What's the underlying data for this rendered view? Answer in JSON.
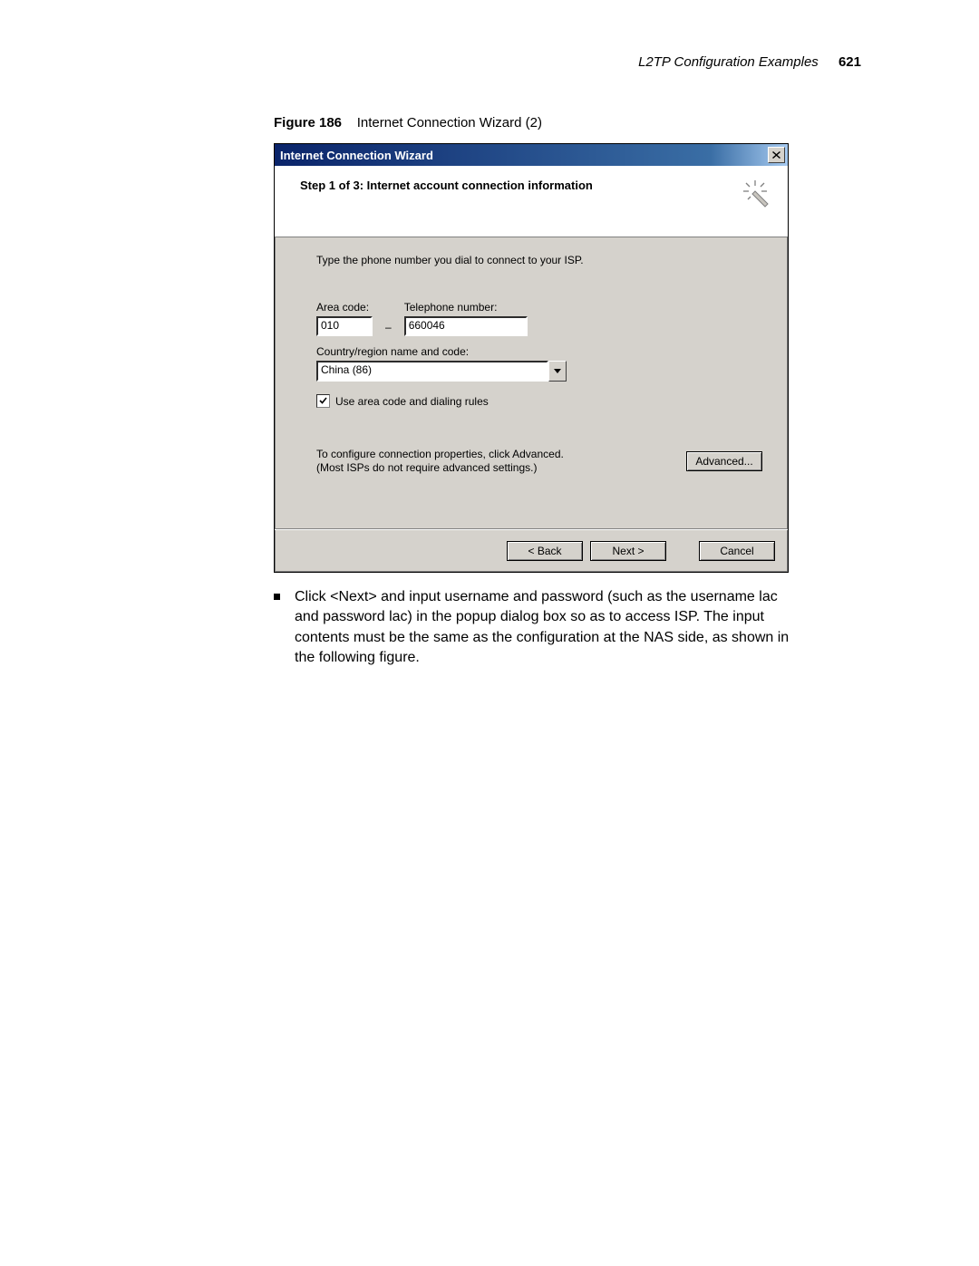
{
  "header": {
    "section": "L2TP Configuration Examples",
    "page_number": "621"
  },
  "figure": {
    "label": "Figure 186",
    "caption": "Internet Connection Wizard (2)"
  },
  "dialog": {
    "title": "Internet Connection Wizard",
    "step_title": "Step 1 of 3: Internet account connection information",
    "instruction": "Type the phone number you dial to connect to your ISP.",
    "area_code_label": "Area code:",
    "area_code_value": "010",
    "telephone_label": "Telephone number:",
    "telephone_value": "660046",
    "country_label": "Country/region name and code:",
    "country_value": "China (86)",
    "use_dialing_rules": "Use area code and dialing rules",
    "advanced_text_1": "To configure connection properties, click Advanced.",
    "advanced_text_2": "(Most ISPs do not require advanced settings.)",
    "advanced_button": "Advanced...",
    "back_button": "< Back",
    "next_button": "Next >",
    "cancel_button": "Cancel"
  },
  "bullet_text": "Click <Next> and input username and password (such as the username lac and password lac) in the popup dialog box so as to access ISP. The input contents must be the same as the configuration at the NAS side, as shown in the following figure."
}
